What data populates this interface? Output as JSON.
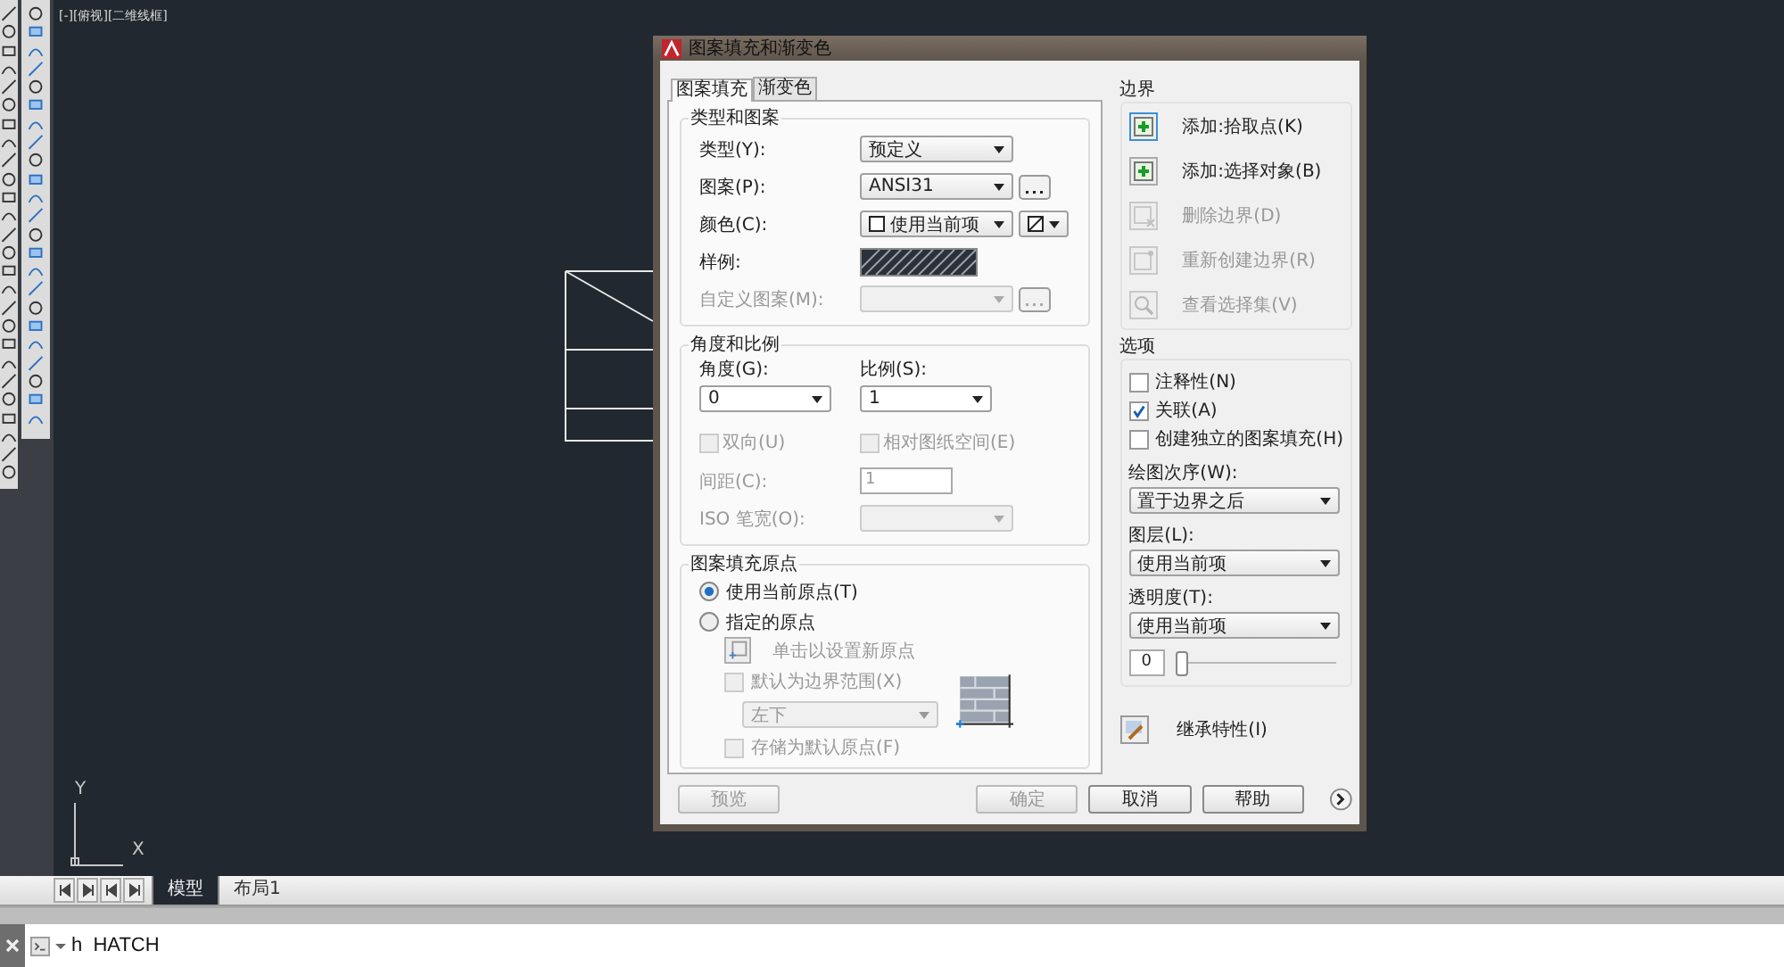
{
  "viewport_label": "[-][俯视][二维线框]",
  "dialog": {
    "title": "图案填充和渐变色",
    "tabs": [
      {
        "label": "图案填充",
        "selected": true
      },
      {
        "label": "渐变色",
        "selected": false
      }
    ],
    "type_group": {
      "title": "类型和图案",
      "rows": [
        {
          "kind": "select",
          "label": "类型(Y):",
          "value": "预定义",
          "disabled": false
        },
        {
          "kind": "select_more",
          "label": "图案(P):",
          "value": "ANSI31",
          "disabled": false
        },
        {
          "kind": "color",
          "label": "颜色(C):",
          "value": "使用当前项",
          "disabled": false
        },
        {
          "kind": "swatch",
          "label": "样例:",
          "disabled": false
        },
        {
          "kind": "select_more",
          "label": "自定义图案(M):",
          "disabled": true
        }
      ]
    },
    "angle_group": {
      "title": "角度和比例",
      "angle": {
        "label": "角度(G):",
        "value": "0"
      },
      "scale": {
        "label": "比例(S):",
        "value": "1"
      },
      "checks": [
        {
          "label": "双向(U)",
          "checked": false,
          "disabled": true
        },
        {
          "label": "相对图纸空间(E)",
          "checked": false,
          "disabled": true
        }
      ],
      "spacing": {
        "label": "间距(C):",
        "value": "1",
        "disabled": true
      },
      "iso": {
        "label": "ISO 笔宽(O):",
        "disabled": true
      }
    },
    "origin_group": {
      "title": "图案填充原点",
      "radios": [
        {
          "label": "使用当前原点(T)",
          "selected": true
        },
        {
          "label": "指定的原点",
          "selected": false
        }
      ],
      "set_origin": {
        "label": "单击以设置新原点",
        "disabled": true
      },
      "default_extents": {
        "label": "默认为边界范围(X)",
        "checked": false,
        "disabled": true
      },
      "position": {
        "value": "左下",
        "disabled": true
      },
      "store_default": {
        "label": "存储为默认原点(F)",
        "checked": false,
        "disabled": true
      }
    },
    "boundaries": {
      "title": "边界",
      "buttons": [
        {
          "kind": "pick",
          "label": "添加:拾取点(K)",
          "disabled": false
        },
        {
          "kind": "select",
          "label": "添加:选择对象(B)",
          "disabled": false
        },
        {
          "kind": "remove",
          "label": "删除边界(D)",
          "disabled": true
        },
        {
          "kind": "recreate",
          "label": "重新创建边界(R)",
          "disabled": true
        },
        {
          "kind": "view",
          "label": "查看选择集(V)",
          "disabled": true
        }
      ]
    },
    "options": {
      "title": "选项",
      "checks": [
        {
          "label": "注释性(N)",
          "checked": false
        },
        {
          "label": "关联(A)",
          "checked": true
        },
        {
          "label": "创建独立的图案填充(H)",
          "checked": false
        }
      ],
      "selects": [
        {
          "label": "绘图次序(W):",
          "value": "置于边界之后"
        },
        {
          "label": "图层(L):",
          "value": "使用当前项"
        },
        {
          "label": "透明度(T):",
          "value": "使用当前项"
        }
      ],
      "transparency_value": "0",
      "transparency_slider": {
        "level": 0
      }
    },
    "inherit": {
      "label": "继承特性(I)"
    },
    "buttons": [
      {
        "label": "预览",
        "disabled": true
      },
      {
        "label": "确定",
        "disabled": true
      },
      {
        "label": "取消",
        "disabled": false
      },
      {
        "label": "帮助",
        "disabled": false
      }
    ]
  },
  "layout_tabs": [
    {
      "label": "模型",
      "selected": true
    },
    {
      "label": "布局1",
      "selected": false
    }
  ],
  "ucs": {
    "y": "Y",
    "x": "X"
  },
  "command": "h  HATCH"
}
